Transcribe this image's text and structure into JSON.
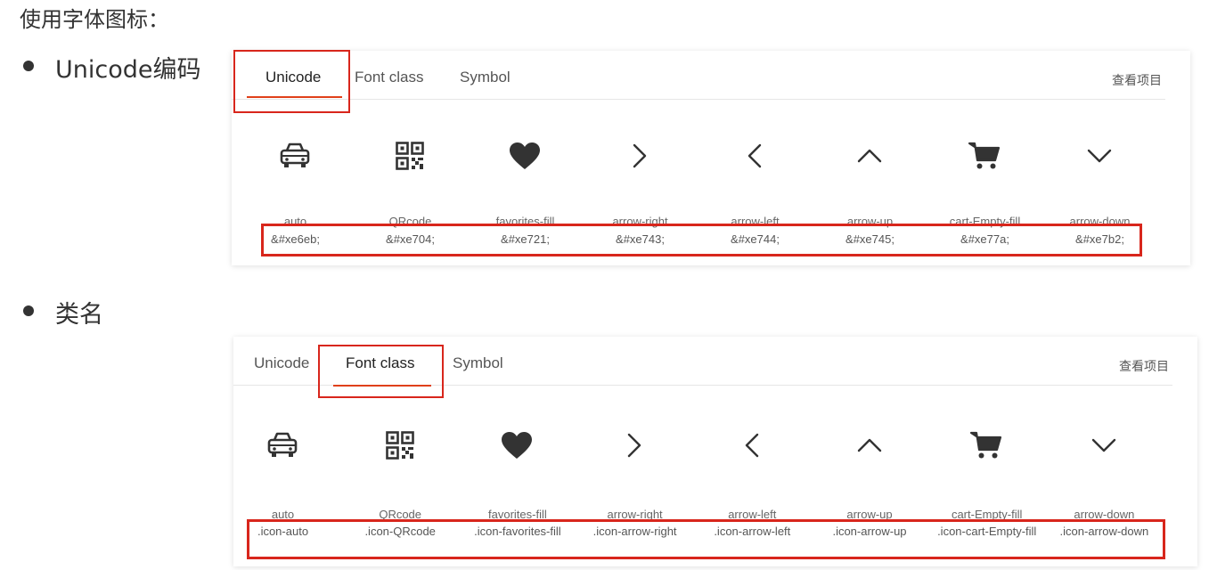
{
  "heading": "使用字体图标：",
  "sections": [
    {
      "bullet": "Unicode编码"
    },
    {
      "bullet": "类名"
    }
  ],
  "tabs": [
    "Unicode",
    "Font class",
    "Symbol"
  ],
  "view_link": "查看项目",
  "icons": [
    {
      "icon": "car-icon",
      "name": "auto",
      "unicode": "&#xe6eb;",
      "class": ".icon-auto"
    },
    {
      "icon": "qrcode-icon",
      "name": "QRcode",
      "unicode": "&#xe704;",
      "class": ".icon-QRcode"
    },
    {
      "icon": "heart-icon",
      "name": "favorites-fill",
      "unicode": "&#xe721;",
      "class": ".icon-favorites-fill"
    },
    {
      "icon": "arrow-right-icon",
      "name": "arrow-right",
      "unicode": "&#xe743;",
      "class": ".icon-arrow-right"
    },
    {
      "icon": "arrow-left-icon",
      "name": "arrow-left",
      "unicode": "&#xe744;",
      "class": ".icon-arrow-left"
    },
    {
      "icon": "arrow-up-icon",
      "name": "arrow-up",
      "unicode": "&#xe745;",
      "class": ".icon-arrow-up"
    },
    {
      "icon": "cart-icon",
      "name": "cart-Empty-fill",
      "unicode": "&#xe77a;",
      "class": ".icon-cart-Empty-fill"
    },
    {
      "icon": "arrow-down-icon",
      "name": "arrow-down",
      "unicode": "&#xe7b2;",
      "class": ".icon-arrow-down"
    }
  ],
  "colors": {
    "accent": "#e0401a",
    "highlight": "#d8261c",
    "icon": "#333333"
  }
}
